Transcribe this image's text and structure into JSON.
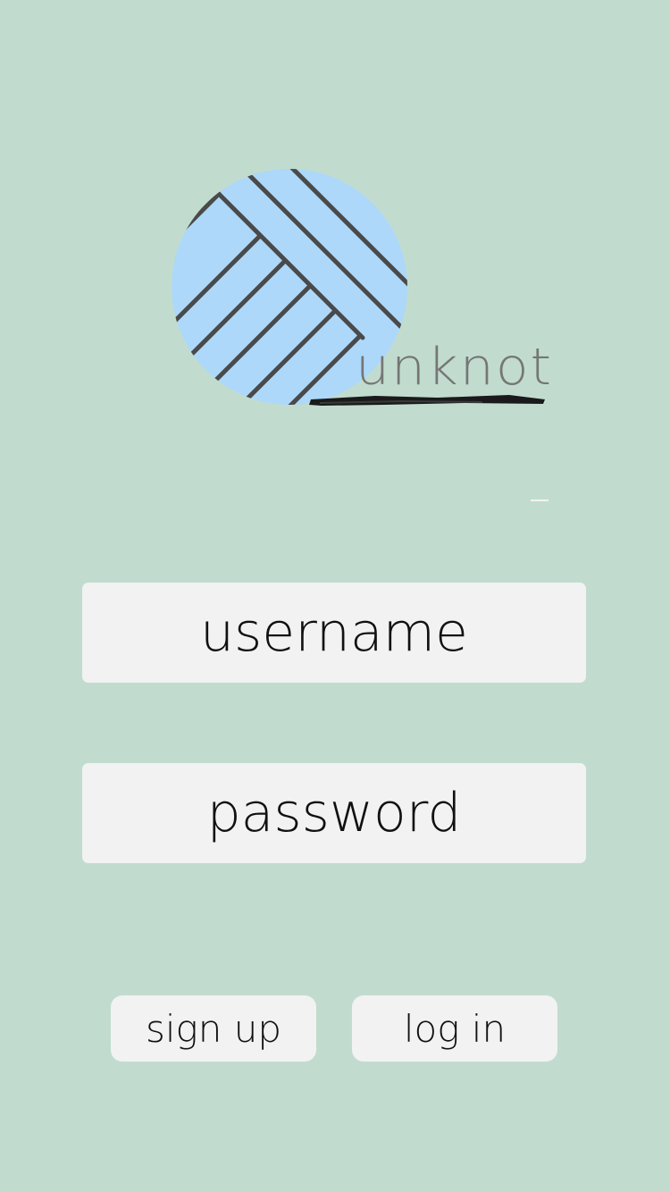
{
  "logo": {
    "wordmark": "unknot",
    "icon": "yarn-ball-icon",
    "ball_color": "#add8f9",
    "stripe_color": "#4a4a4a",
    "wordmark_color": "#767676"
  },
  "login_form": {
    "username_placeholder": "username",
    "password_placeholder": "password"
  },
  "actions": {
    "signup_label": "sign up",
    "login_label": "log in"
  },
  "colors": {
    "background": "#c1dccf",
    "field_background": "#f2f2f2",
    "text": "#111111"
  }
}
